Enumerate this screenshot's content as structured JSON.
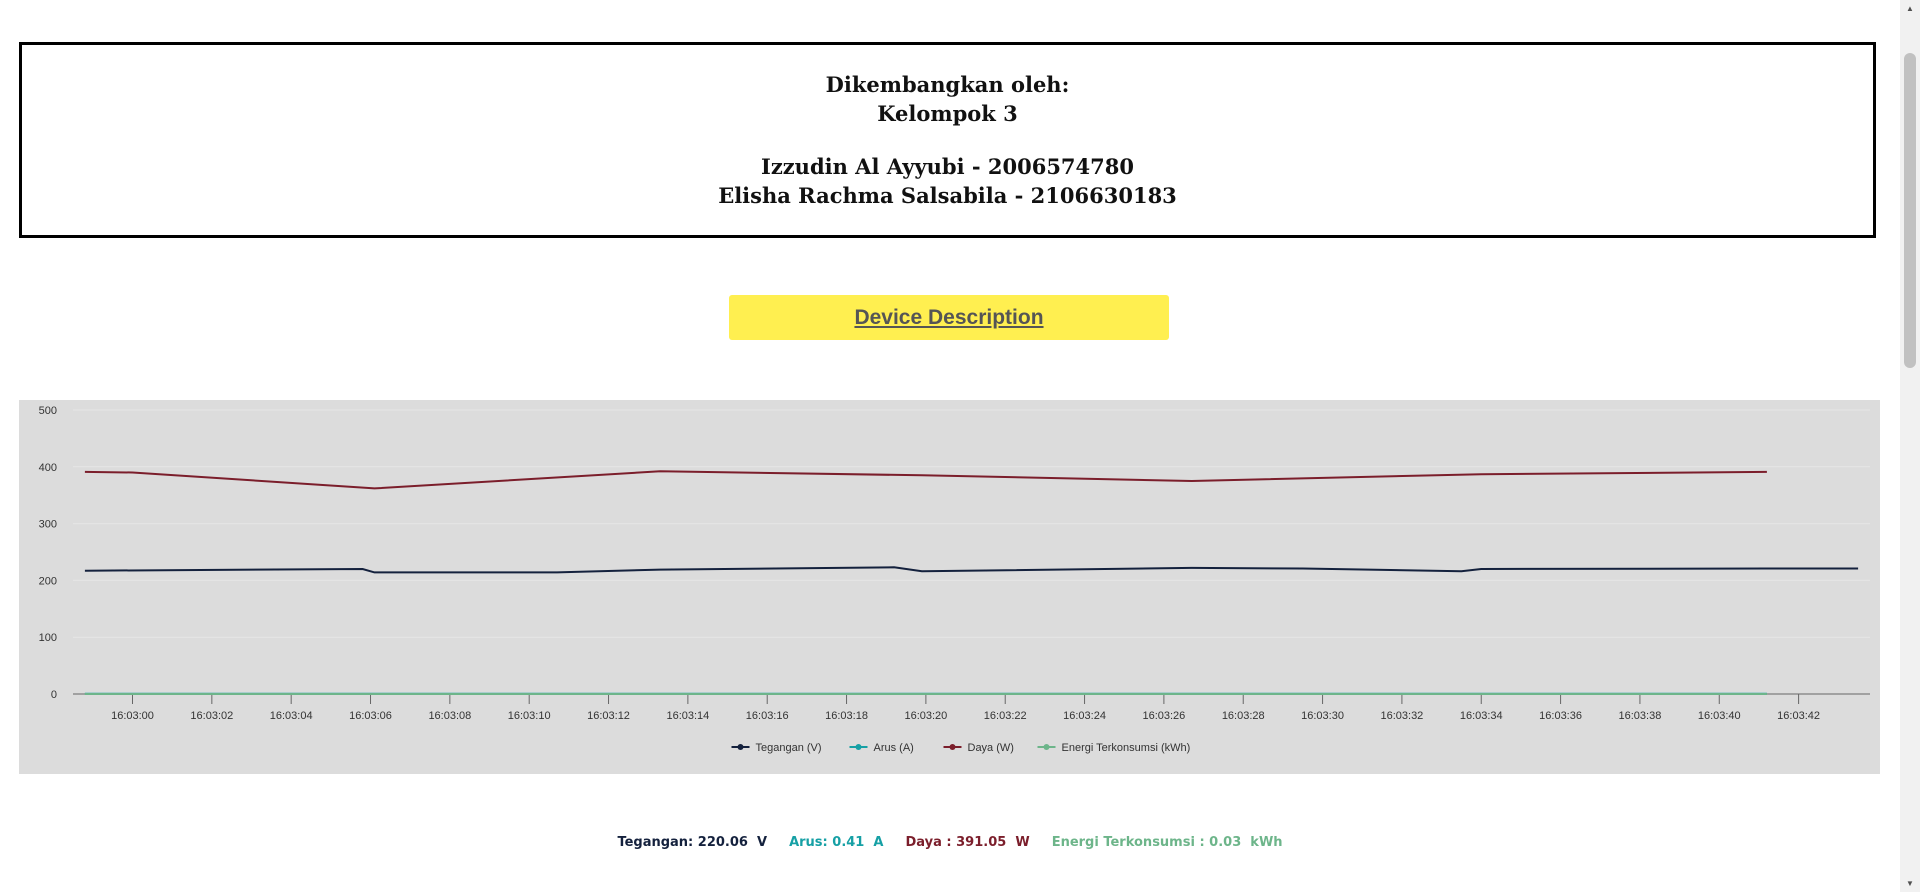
{
  "credits": {
    "line1": "Dikembangkan oleh:",
    "line2": "Kelompok 3",
    "member1": "Izzudin Al Ayyubi - 2006574780",
    "member2": "Elisha Rachma Salsabila - 2106630183"
  },
  "device_button": {
    "label": "Device Description"
  },
  "readout": {
    "tegangan": "Tegangan: 220.06  V",
    "arus": "Arus: 0.41  A",
    "daya": "Daya : 391.05  W",
    "energi": "Energi Terkonsumsi : 0.03  kWh"
  },
  "colors": {
    "tegangan": "#14213d",
    "arus": "#16a0a5",
    "daya": "#7b1e2b",
    "energi": "#6db58a",
    "panel": "#dcdcdc"
  },
  "chart_data": {
    "type": "line",
    "ylim": [
      0,
      500
    ],
    "yticks": [
      0,
      100,
      200,
      300,
      400,
      500
    ],
    "x_ticks": [
      "16:03:00",
      "16:03:02",
      "16:03:04",
      "16:03:06",
      "16:03:08",
      "16:03:10",
      "16:03:12",
      "16:03:14",
      "16:03:16",
      "16:03:18",
      "16:03:20",
      "16:03:22",
      "16:03:24",
      "16:03:26",
      "16:03:28",
      "16:03:30",
      "16:03:32",
      "16:03:34",
      "16:03:36",
      "16:03:38",
      "16:03:40",
      "16:03:42"
    ],
    "x_range_seconds": [
      -1.5,
      43.8
    ],
    "legend_position": "bottom-center",
    "series": [
      {
        "name": "Tegangan (V)",
        "color": "#14213d",
        "points": [
          [
            -1.2,
            217
          ],
          [
            5.8,
            220
          ],
          [
            6.1,
            214
          ],
          [
            10.7,
            214
          ],
          [
            13.3,
            219
          ],
          [
            19.2,
            223
          ],
          [
            19.9,
            216
          ],
          [
            26.7,
            222
          ],
          [
            29.5,
            221
          ],
          [
            33.5,
            216
          ],
          [
            34,
            220
          ],
          [
            41.2,
            221
          ],
          [
            43.5,
            221
          ]
        ]
      },
      {
        "name": "Arus (A)",
        "color": "#16a0a5",
        "points": [
          [
            -1.2,
            0.4
          ],
          [
            6.1,
            0.39
          ],
          [
            13.3,
            0.41
          ],
          [
            19.9,
            0.4
          ],
          [
            26.7,
            0.4
          ],
          [
            34,
            0.4
          ],
          [
            41.2,
            0.41
          ]
        ]
      },
      {
        "name": "Daya (W)",
        "color": "#7b1e2b",
        "points": [
          [
            -1.2,
            391
          ],
          [
            0,
            390
          ],
          [
            6.1,
            362
          ],
          [
            13.3,
            392
          ],
          [
            19.9,
            385
          ],
          [
            26.7,
            375
          ],
          [
            34,
            387
          ],
          [
            41.2,
            391
          ]
        ]
      },
      {
        "name": "Energi Terkonsumsi (kWh)",
        "color": "#6db58a",
        "points": [
          [
            -1.2,
            0.02
          ],
          [
            41.2,
            0.03
          ]
        ]
      }
    ]
  }
}
